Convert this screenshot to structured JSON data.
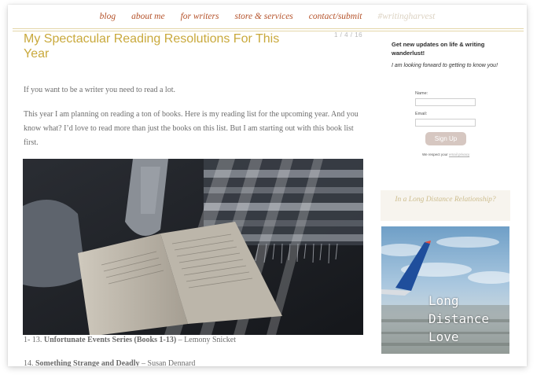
{
  "nav": {
    "items": [
      "blog",
      "about me",
      "for writers",
      "store & services",
      "contact/submit",
      "#writingharvest"
    ]
  },
  "post": {
    "title": "My Spectacular Reading Resolutions For This Year",
    "pager": "1 / 4 / 16",
    "paragraph_1": "If you want to be a writer you need to read a lot.",
    "paragraph_2": "This year I am planning on reading a ton of books. Here is my reading list for the upcoming year. And you know what? I’d love to read more than just the books on this list. But I am starting out with this book list first.",
    "list": [
      {
        "prefix": "1- 13. ",
        "title": "Unfortunate Events Series (Books 1-13)",
        "suffix": " – Lemony Snicket"
      },
      {
        "prefix": "14. ",
        "title": "Something Strange and Deadly",
        "suffix": " – Susan Dennard"
      }
    ]
  },
  "sidebar": {
    "heading": "Get new updates on life & writing wanderlust!",
    "subheading": "I am looking forward to getting to know you!",
    "name_label": "Name:",
    "name_value": "",
    "email_label": "Email:",
    "email_value": "",
    "signup_label": "Sign Up",
    "privacy_text": "We respect your ",
    "privacy_link": "email privacy",
    "ld_heading": "In a Long Distance Relationship?",
    "ld_image_text": "Long Distance Love"
  },
  "colors": {
    "nav_link": "#b5532b",
    "title": "#c9a93c",
    "body_text": "#6d6d6d",
    "button": "#d6c7c1"
  }
}
